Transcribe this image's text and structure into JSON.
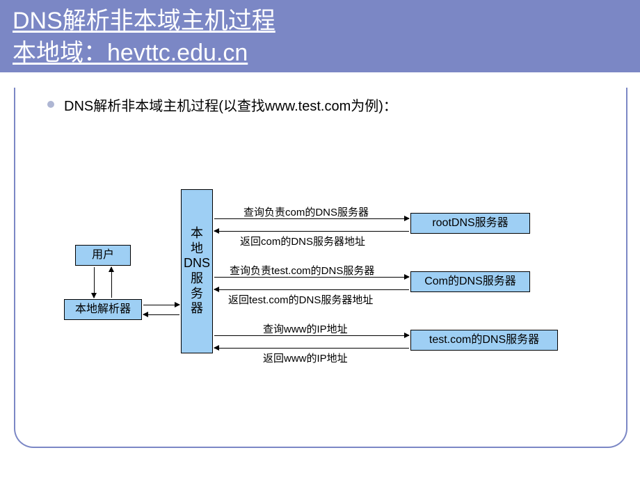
{
  "title": {
    "line1": "DNS解析非本域主机过程",
    "line2": "本地域：hevttc.edu.cn"
  },
  "bullet": "DNS解析非本域主机过程(以查找www.test.com为例)：",
  "nodes": {
    "user": "用户",
    "localResolver": "本地解析器",
    "localDns": "本地DNS服务器",
    "rootDns": "rootDNS服务器",
    "comDns": "Com的DNS服务器",
    "testDns": "test.com的DNS服务器"
  },
  "arrows": {
    "q1": "查询负责com的DNS服务器",
    "r1": "返回com的DNS服务器地址",
    "q2": "查询负责test.com的DNS服务器",
    "r2": "返回test.com的DNS服务器地址",
    "q3": "查询www的IP地址",
    "r3": "返回www的IP地址"
  }
}
